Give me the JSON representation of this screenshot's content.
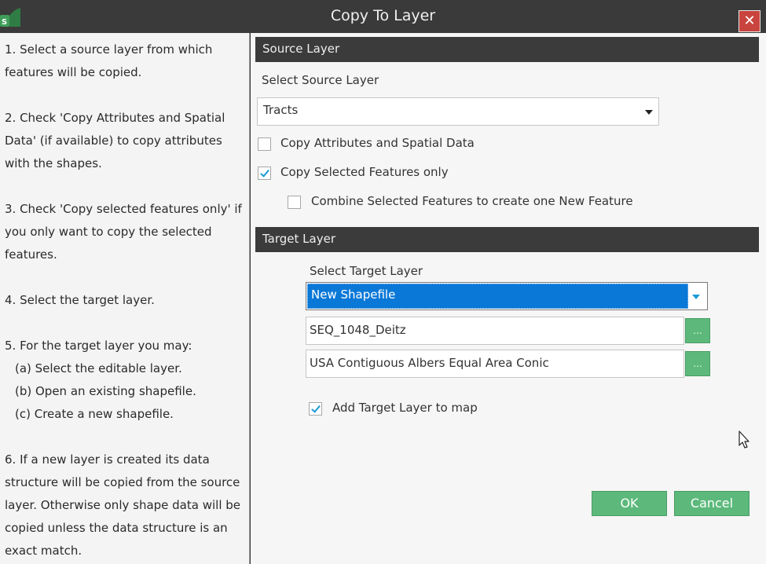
{
  "window": {
    "title": "Copy To Layer",
    "close_label": "✕"
  },
  "help": {
    "steps": [
      "1. Select a source layer from which features will be copied.",
      "2. Check 'Copy Attributes and Spatial Data' (if available) to copy attributes with the shapes.",
      "3. Check 'Copy selected features only' if you only want to copy the selected features.",
      "4. Select the target layer.",
      "5. For the target layer you may:",
      "6. If a new layer is created its data structure will be copied from the source layer. Otherwise only shape data will be copied unless the data structure is an exact match."
    ],
    "step5_options": [
      "(a) Select the editable layer.",
      "(b) Open an existing shapefile.",
      "(c) Create a new shapefile."
    ]
  },
  "source": {
    "header": "Source Layer",
    "select_label": "Select Source Layer",
    "selected_layer": "Tracts",
    "copy_attributes": {
      "label": "Copy Attributes and Spatial Data",
      "checked": false
    },
    "copy_selected_only": {
      "label": "Copy Selected Features only",
      "checked": true
    },
    "combine_selected": {
      "label": "Combine Selected Features to create one New Feature",
      "checked": false
    }
  },
  "target": {
    "header": "Target Layer",
    "select_label": "Select Target Layer",
    "selected_layer": "New Shapefile",
    "filename": "SEQ_1048_Deitz",
    "projection": "USA Contiguous Albers Equal Area Conic",
    "browse_label": "...",
    "add_to_map": {
      "label": "Add Target Layer to map",
      "checked": true
    }
  },
  "buttons": {
    "ok": "OK",
    "cancel": "Cancel"
  },
  "colors": {
    "accent_green": "#5cb97b",
    "selection_blue": "#0a78d7",
    "header_dark": "#3b3b3b",
    "close_red": "#c9443e"
  }
}
